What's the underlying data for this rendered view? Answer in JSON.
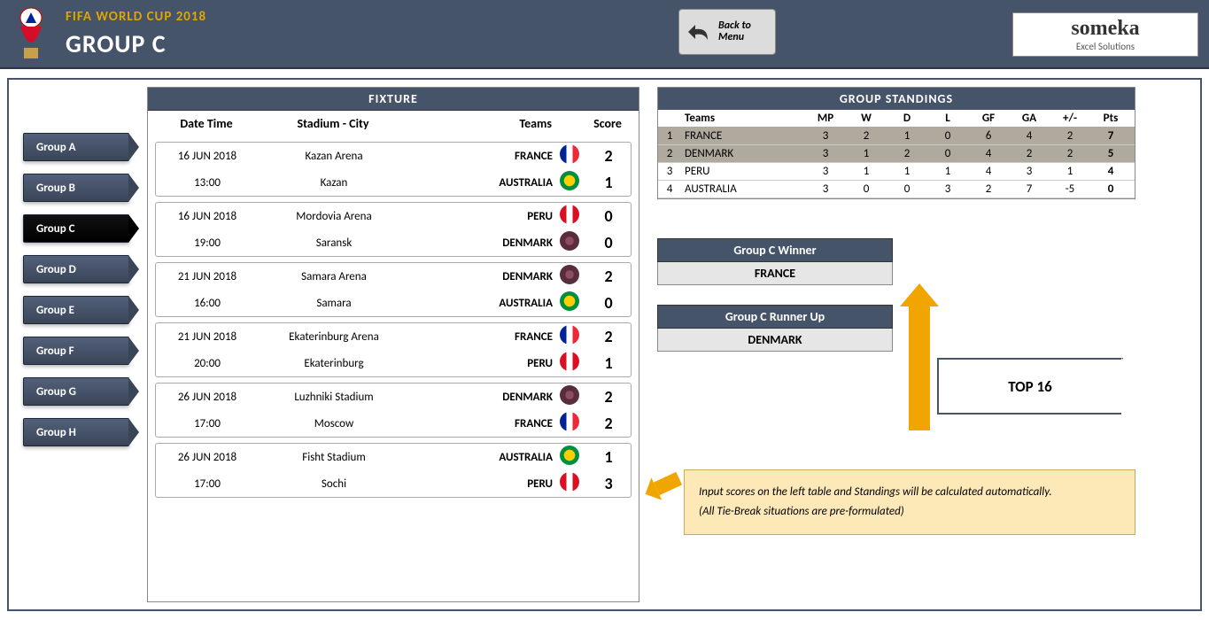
{
  "header": {
    "title1": "FIFA WORLD CUP 2018",
    "title2": "GROUP C",
    "back_line1": "Back to",
    "back_line2": "Menu",
    "logo_main": "someka",
    "logo_sub": "Excel Solutions"
  },
  "nav": {
    "items": [
      "Group A",
      "Group B",
      "Group C",
      "Group D",
      "Group E",
      "Group F",
      "Group G",
      "Group H"
    ],
    "active_index": 2
  },
  "fixture": {
    "title": "FIXTURE",
    "cols": {
      "date": "Date Time",
      "stadium": "Stadium - City",
      "teams": "Teams",
      "score": "Score"
    },
    "matches": [
      {
        "date": "16 JUN 2018",
        "time": "13:00",
        "stadium": "Kazan Arena",
        "city": "Kazan",
        "team1": "FRANCE",
        "flag1": "france",
        "score1": "2",
        "team2": "AUSTRALIA",
        "flag2": "australia",
        "score2": "1"
      },
      {
        "date": "16 JUN 2018",
        "time": "19:00",
        "stadium": "Mordovia Arena",
        "city": "Saransk",
        "team1": "PERU",
        "flag1": "peru",
        "score1": "0",
        "team2": "DENMARK",
        "flag2": "denmark",
        "score2": "0"
      },
      {
        "date": "21 JUN 2018",
        "time": "16:00",
        "stadium": "Samara Arena",
        "city": "Samara",
        "team1": "DENMARK",
        "flag1": "denmark",
        "score1": "2",
        "team2": "AUSTRALIA",
        "flag2": "australia",
        "score2": "0"
      },
      {
        "date": "21 JUN 2018",
        "time": "20:00",
        "stadium": "Ekaterinburg Arena",
        "city": "Ekaterinburg",
        "team1": "FRANCE",
        "flag1": "france",
        "score1": "2",
        "team2": "PERU",
        "flag2": "peru",
        "score2": "1"
      },
      {
        "date": "26 JUN 2018",
        "time": "17:00",
        "stadium": "Luzhniki Stadium",
        "city": "Moscow",
        "team1": "DENMARK",
        "flag1": "denmark",
        "score1": "2",
        "team2": "FRANCE",
        "flag2": "france",
        "score2": "2"
      },
      {
        "date": "26 JUN 2018",
        "time": "17:00",
        "stadium": "Fisht Stadium",
        "city": "Sochi",
        "team1": "AUSTRALIA",
        "flag1": "australia",
        "score1": "1",
        "team2": "PERU",
        "flag2": "peru",
        "score2": "3"
      }
    ]
  },
  "standings": {
    "title": "GROUP STANDINGS",
    "cols": [
      "Teams",
      "MP",
      "W",
      "D",
      "L",
      "GF",
      "GA",
      "+/-",
      "Pts"
    ],
    "rows": [
      {
        "rank": 1,
        "team": "FRANCE",
        "mp": 3,
        "w": 2,
        "d": 1,
        "l": 0,
        "gf": 6,
        "ga": 4,
        "diff": "2",
        "pts": 7,
        "qualified": true
      },
      {
        "rank": 2,
        "team": "DENMARK",
        "mp": 3,
        "w": 1,
        "d": 2,
        "l": 0,
        "gf": 4,
        "ga": 2,
        "diff": "2",
        "pts": 5,
        "qualified": true
      },
      {
        "rank": 3,
        "team": "PERU",
        "mp": 3,
        "w": 1,
        "d": 1,
        "l": 1,
        "gf": 4,
        "ga": 3,
        "diff": "1",
        "pts": 4,
        "qualified": false
      },
      {
        "rank": 4,
        "team": "AUSTRALIA",
        "mp": 3,
        "w": 0,
        "d": 0,
        "l": 3,
        "gf": 2,
        "ga": 7,
        "diff": "-5",
        "pts": 0,
        "qualified": false
      }
    ]
  },
  "results": {
    "winner_label": "Group C Winner",
    "winner_value": "FRANCE",
    "runnerup_label": "Group C Runner Up",
    "runnerup_value": "DENMARK",
    "top16_label": "TOP 16"
  },
  "note": {
    "line1": "Input scores on the left table and Standings will be calculated automatically.",
    "line2": "(All Tie-Break situations are pre-formulated)"
  }
}
